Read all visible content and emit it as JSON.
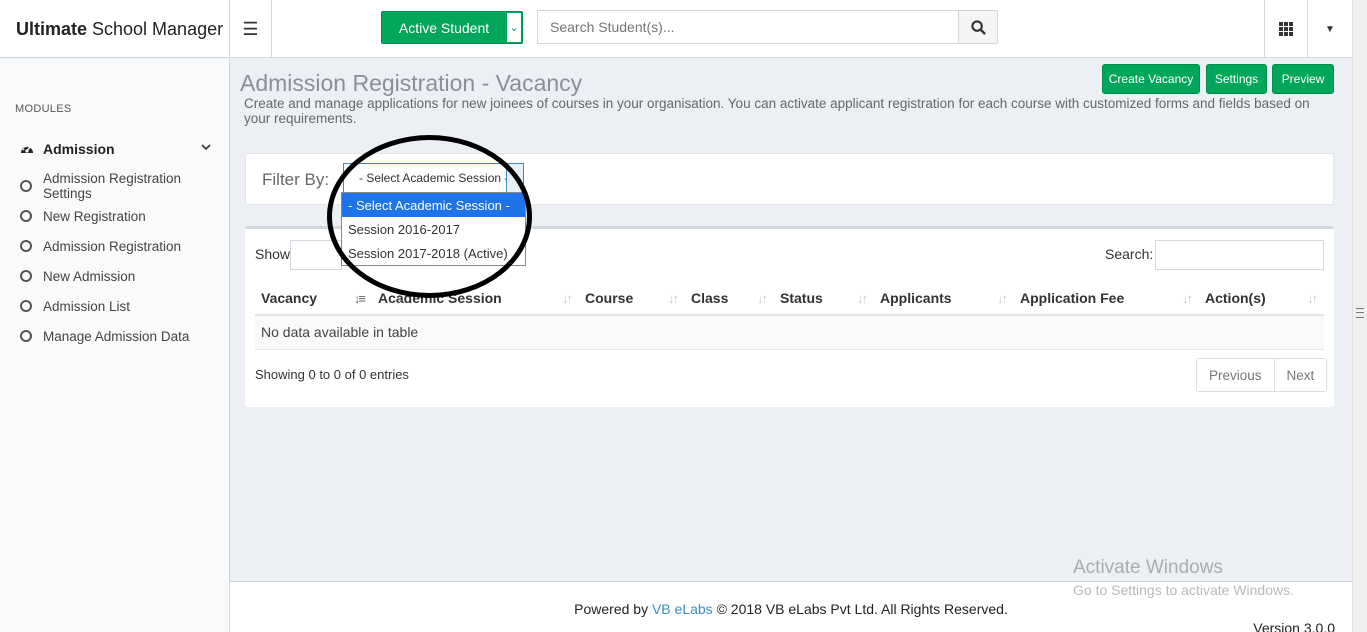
{
  "header": {
    "brand_bold": "Ultimate",
    "brand_rest": "School Manager",
    "active_student_label": "Active Student",
    "search_placeholder": "Search Student(s)..."
  },
  "sidebar": {
    "section_label": "MODULES",
    "module": "Admission",
    "items": [
      {
        "label": "Admission Registration Settings"
      },
      {
        "label": "New Registration"
      },
      {
        "label": "Admission Registration"
      },
      {
        "label": "New Admission"
      },
      {
        "label": "Admission List"
      },
      {
        "label": "Manage Admission Data"
      }
    ]
  },
  "page": {
    "title": "Admission Registration - Vacancy",
    "description": "Create and manage applications for new joinees of courses in your organisation. You can activate applicant registration for each course with customized forms and fields based on your requirements.",
    "buttons": {
      "create_vacancy": "Create Vacancy",
      "settings": "Settings",
      "preview": "Preview"
    }
  },
  "filter": {
    "label": "Filter By:",
    "selected": "- Select Academic Session -",
    "options": [
      "- Select Academic Session -",
      "Session 2016-2017",
      "Session 2017-2018 (Active)"
    ],
    "highlighted_index": 0
  },
  "table": {
    "show_label": "Show",
    "search_label": "Search:",
    "columns": [
      "Vacancy",
      "Academic Session",
      "Course",
      "Class",
      "Status",
      "Applicants",
      "Application Fee",
      "Action(s)"
    ],
    "empty_message": "No data available in table",
    "info": "Showing 0 to 0 of 0 entries",
    "prev_label": "Previous",
    "next_label": "Next"
  },
  "footer": {
    "powered_by": "Powered by",
    "company_link": "VB eLabs",
    "copyright": "© 2018 VB eLabs Pvt Ltd. All Rights Reserved.",
    "version": "Version 3.0.0"
  },
  "watermark": {
    "title": "Activate Windows",
    "subtitle": "Go to Settings to activate Windows."
  },
  "colors": {
    "primary_green": "#00a65a",
    "link_blue": "#3c8dbc",
    "dropdown_highlight": "#1e73e8"
  }
}
